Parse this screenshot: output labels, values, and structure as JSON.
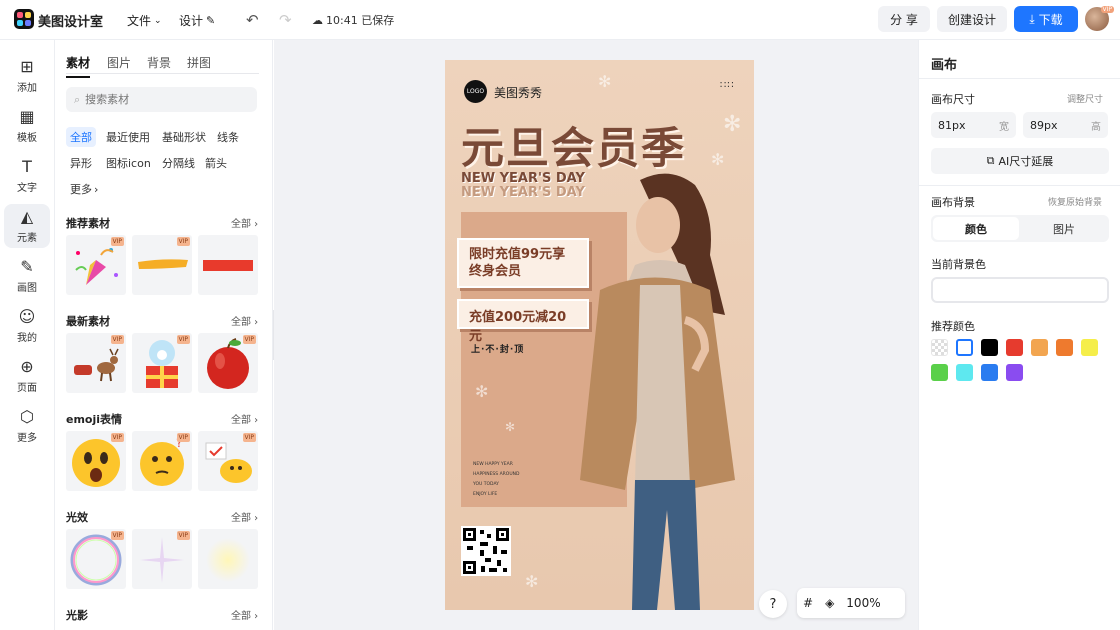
{
  "app": {
    "name": "美图设计室"
  },
  "toolbar": {
    "file": "文件",
    "design": "设计",
    "saved": "10:41 已保存",
    "share": "分 享",
    "create": "创建设计",
    "download": "下载",
    "vip": "VIP"
  },
  "leftnav": [
    {
      "label": "添加",
      "icon": "⊞"
    },
    {
      "label": "模板",
      "icon": "▦"
    },
    {
      "label": "文字",
      "icon": "T"
    },
    {
      "label": "元素",
      "icon": "◭"
    },
    {
      "label": "画图",
      "icon": "✎"
    },
    {
      "label": "我的",
      "icon": "☺"
    },
    {
      "label": "页面",
      "icon": "⊕"
    },
    {
      "label": "更多",
      "icon": "⬡"
    }
  ],
  "panel": {
    "tabs": [
      "素材",
      "图片",
      "背景",
      "拼图"
    ],
    "search_placeholder": "搜索素材",
    "chips": [
      "全部",
      "最近使用",
      "基础形状",
      "线条",
      "异形",
      "图标icon",
      "分隔线",
      "箭头",
      "更多"
    ],
    "more_label": "全部",
    "vip": "VIP",
    "sections": [
      {
        "title": "推荐素材",
        "items": [
          "confetti-popper",
          "yellow-brush-stroke",
          "red-bar"
        ]
      },
      {
        "title": "最新素材",
        "items": [
          "reindeer-sleigh",
          "snow-globe-gift",
          "red-apple"
        ]
      },
      {
        "title": "emoji表情",
        "items": [
          "shocked-emoji",
          "thinking-emoji",
          "chick-emoji"
        ]
      },
      {
        "title": "光效",
        "items": [
          "rainbow-bubble",
          "sparkle-glow",
          "soft-light"
        ]
      },
      {
        "title": "光影",
        "items": []
      }
    ]
  },
  "poster": {
    "logo": "LOGO",
    "brand": "美图秀秀",
    "dots": "∷∷",
    "title": "元旦会员季",
    "en1": "NEW YEAR'S DAY",
    "en2": "NEW YEAR'S DAY",
    "box1_line1": "限时充值99元享",
    "box1_line2": "终身会员",
    "box2": "充值200元减20元",
    "slogan": "上·不·封·顶",
    "small_lines": [
      "NEW HAPPY YEAR",
      "HAPPINESS AROUND",
      "YOU TODAY",
      "ENJOY LIFE"
    ]
  },
  "zoom": {
    "help": "?",
    "level": "100%"
  },
  "rpanel": {
    "title": "画布",
    "size_label": "画布尺寸",
    "size_link": "调整尺寸",
    "width_value": "81px",
    "width_unit": "宽",
    "height_value": "89px",
    "height_unit": "高",
    "ai_extend": "AI尺寸延展",
    "bg_label": "画布背景",
    "bg_reset": "恢复原始背景",
    "seg_color": "颜色",
    "seg_image": "图片",
    "current_bg": "当前背景色",
    "recommend": "推荐颜色",
    "swatches": [
      "transparent",
      "#ffffff",
      "#000000",
      "#e63b2e",
      "#f2a550",
      "#ee7a2e",
      "#f5ee4a",
      "#5ad04a",
      "#5ee8ef",
      "#2a7cf0",
      "#8a4cf0"
    ]
  }
}
